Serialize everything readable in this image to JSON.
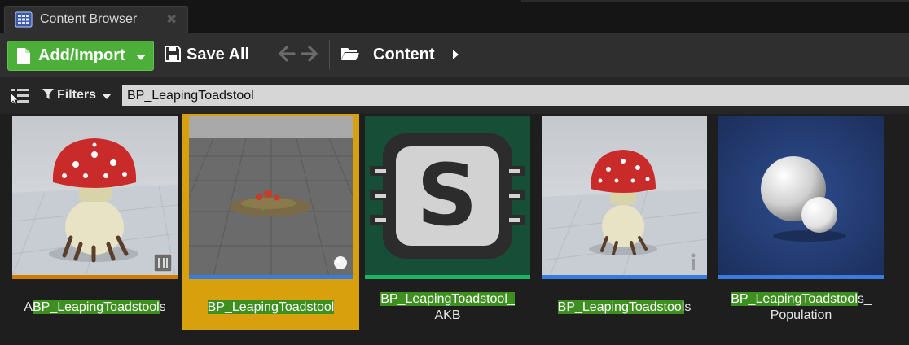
{
  "tab": {
    "title": "Content Browser",
    "close_glyph": "✖",
    "icon": "content-browser-icon"
  },
  "toolbar": {
    "add_import_label": "Add/Import",
    "save_all_label": "Save All",
    "path_label": "Content"
  },
  "filterbar": {
    "filters_label": "Filters",
    "search_value": "BP_LeapingToadstool"
  },
  "colors": {
    "add_button": "#4caf3a",
    "selection": "#d9a00d",
    "highlight": "#3d8f1f",
    "strip_orange": "#d17a00",
    "strip_blue": "#3a7be0",
    "strip_green": "#22b265"
  },
  "assets": [
    {
      "pre": "A",
      "match": "BP_LeapingToadstool",
      "post": "s",
      "line2": "",
      "strip": "#d17a00",
      "badge": "skeleton-icon",
      "selected": false
    },
    {
      "pre": "",
      "match": "BP_LeapingToadstool",
      "post": "",
      "line2": "",
      "strip": "#3a7be0",
      "badge": "sphere-icon",
      "selected": true
    },
    {
      "pre": "",
      "match": "BP_LeapingToadstool_",
      "post": "",
      "line2": "AKB",
      "strip": "#22b265",
      "badge": "",
      "selected": false
    },
    {
      "pre": "",
      "match": "BP_LeapingToadstool",
      "post": "s",
      "line2": "",
      "strip": "#3a7be0",
      "badge": "actor-icon",
      "selected": false
    },
    {
      "pre": "",
      "match": "BP_LeapingToadstool",
      "post": "s_",
      "line2": "Population",
      "strip": "#3a7be0",
      "badge": "",
      "selected": false
    }
  ]
}
